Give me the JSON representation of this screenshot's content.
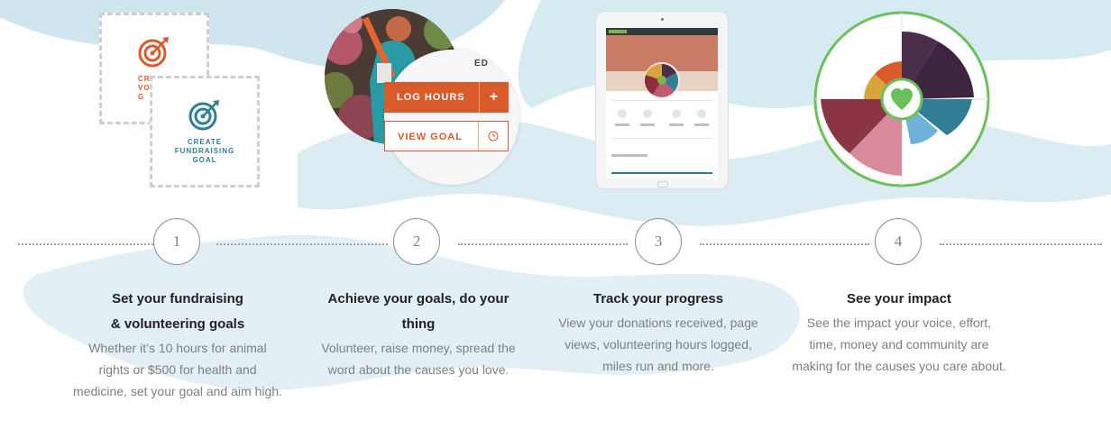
{
  "colors": {
    "accent_orange": "#d95a2b",
    "accent_teal": "#2f7e96",
    "wave": "#cfe6ee",
    "title_text": "#222222",
    "body_text": "#7f7f7f"
  },
  "illustrations": {
    "volunteer_card": {
      "label": "CREATE\nVOLUNTEERING\nGOAL",
      "visible_label": "CR\nVOLUN\nG"
    },
    "fundraising_card": {
      "label": "CREATE\nFUNDRAISING\nGOAL"
    },
    "menu": {
      "edit_label": "ED",
      "log_hours_label": "LOG HOURS",
      "log_hours_icon": "plus-icon",
      "view_goal_label": "VIEW GOAL",
      "view_goal_icon": "clock-icon"
    },
    "impact_icon": "heart-icon"
  },
  "steps": [
    {
      "number": "1",
      "title": "Set your fundraising & volunteering goals",
      "description": "Whether it’s 10 hours for animal rights or $500 for health and medicine, set your goal and aim high."
    },
    {
      "number": "2",
      "title": "Achieve your goals, do your thing",
      "description": "Volunteer, raise money, spread the word about the causes you love."
    },
    {
      "number": "3",
      "title": "Track your progress",
      "description": "View your donations received, page views, volunteering hours logged, miles run and more."
    },
    {
      "number": "4",
      "title": "See your impact",
      "description": "See the impact your voice, effort, time, money and community are making for the causes you care about."
    }
  ]
}
